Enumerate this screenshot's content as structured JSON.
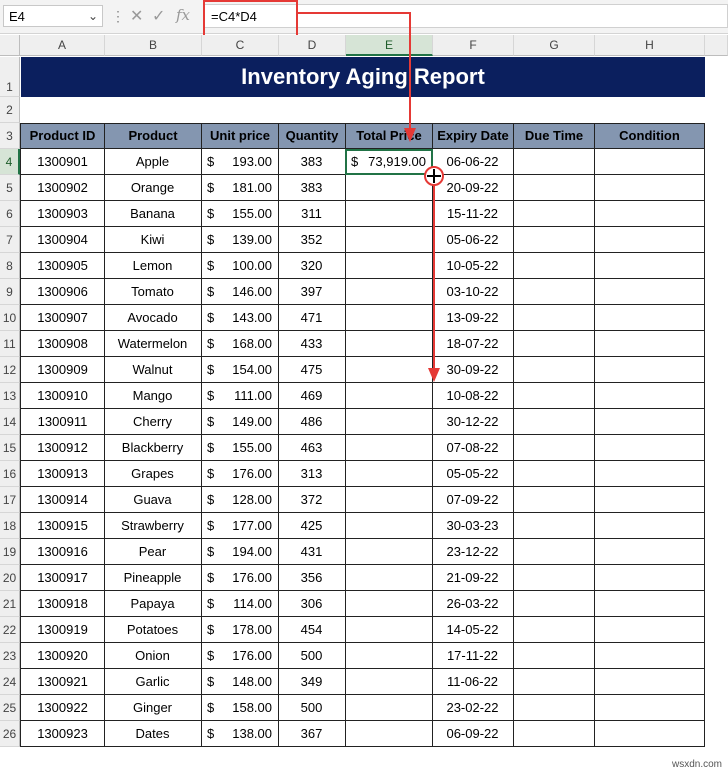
{
  "formula_bar": {
    "name_box": "E4",
    "formula": "=C4*D4",
    "fx_label": "fx"
  },
  "columns": [
    "A",
    "B",
    "C",
    "D",
    "E",
    "F",
    "G",
    "H"
  ],
  "rows": [
    "1",
    "2",
    "3",
    "4",
    "5",
    "6",
    "7",
    "8",
    "9",
    "10",
    "11",
    "12",
    "13",
    "14",
    "15",
    "16",
    "17",
    "18",
    "19",
    "20",
    "21",
    "22",
    "23",
    "24",
    "25",
    "26"
  ],
  "report": {
    "title": "Inventory Aging Report",
    "headers": [
      "Product ID",
      "Product",
      "Unit price",
      "Quantity",
      "Total Price",
      "Expiry Date",
      "Due Time",
      "Condition"
    ],
    "currency_symbol": "$",
    "rows": [
      {
        "id": "1300901",
        "product": "Apple",
        "price": "193.00",
        "qty": "383",
        "total": "73,919.00",
        "expiry": "06-06-22"
      },
      {
        "id": "1300902",
        "product": "Orange",
        "price": "181.00",
        "qty": "383",
        "total": "",
        "expiry": "20-09-22"
      },
      {
        "id": "1300903",
        "product": "Banana",
        "price": "155.00",
        "qty": "311",
        "total": "",
        "expiry": "15-11-22"
      },
      {
        "id": "1300904",
        "product": "Kiwi",
        "price": "139.00",
        "qty": "352",
        "total": "",
        "expiry": "05-06-22"
      },
      {
        "id": "1300905",
        "product": "Lemon",
        "price": "100.00",
        "qty": "320",
        "total": "",
        "expiry": "10-05-22"
      },
      {
        "id": "1300906",
        "product": "Tomato",
        "price": "146.00",
        "qty": "397",
        "total": "",
        "expiry": "03-10-22"
      },
      {
        "id": "1300907",
        "product": "Avocado",
        "price": "143.00",
        "qty": "471",
        "total": "",
        "expiry": "13-09-22"
      },
      {
        "id": "1300908",
        "product": "Watermelon",
        "price": "168.00",
        "qty": "433",
        "total": "",
        "expiry": "18-07-22"
      },
      {
        "id": "1300909",
        "product": "Walnut",
        "price": "154.00",
        "qty": "475",
        "total": "",
        "expiry": "30-09-22"
      },
      {
        "id": "1300910",
        "product": "Mango",
        "price": "111.00",
        "qty": "469",
        "total": "",
        "expiry": "10-08-22"
      },
      {
        "id": "1300911",
        "product": "Cherry",
        "price": "149.00",
        "qty": "486",
        "total": "",
        "expiry": "30-12-22"
      },
      {
        "id": "1300912",
        "product": "Blackberry",
        "price": "155.00",
        "qty": "463",
        "total": "",
        "expiry": "07-08-22"
      },
      {
        "id": "1300913",
        "product": "Grapes",
        "price": "176.00",
        "qty": "313",
        "total": "",
        "expiry": "05-05-22"
      },
      {
        "id": "1300914",
        "product": "Guava",
        "price": "128.00",
        "qty": "372",
        "total": "",
        "expiry": "07-09-22"
      },
      {
        "id": "1300915",
        "product": "Strawberry",
        "price": "177.00",
        "qty": "425",
        "total": "",
        "expiry": "30-03-23"
      },
      {
        "id": "1300916",
        "product": "Pear",
        "price": "194.00",
        "qty": "431",
        "total": "",
        "expiry": "23-12-22"
      },
      {
        "id": "1300917",
        "product": "Pineapple",
        "price": "176.00",
        "qty": "356",
        "total": "",
        "expiry": "21-09-22"
      },
      {
        "id": "1300918",
        "product": "Papaya",
        "price": "114.00",
        "qty": "306",
        "total": "",
        "expiry": "26-03-22"
      },
      {
        "id": "1300919",
        "product": "Potatoes",
        "price": "178.00",
        "qty": "454",
        "total": "",
        "expiry": "14-05-22"
      },
      {
        "id": "1300920",
        "product": "Onion",
        "price": "176.00",
        "qty": "500",
        "total": "",
        "expiry": "17-11-22"
      },
      {
        "id": "1300921",
        "product": "Garlic",
        "price": "148.00",
        "qty": "349",
        "total": "",
        "expiry": "11-06-22"
      },
      {
        "id": "1300922",
        "product": "Ginger",
        "price": "158.00",
        "qty": "500",
        "total": "",
        "expiry": "23-02-22"
      },
      {
        "id": "1300923",
        "product": "Dates",
        "price": "138.00",
        "qty": "367",
        "total": "",
        "expiry": "06-09-22"
      }
    ]
  },
  "watermark": "wsxdn.com",
  "colors": {
    "title_bg": "#0b1f5e",
    "header_bg": "#8496b0",
    "annotation_red": "#e53935",
    "selection_green": "#217346"
  }
}
